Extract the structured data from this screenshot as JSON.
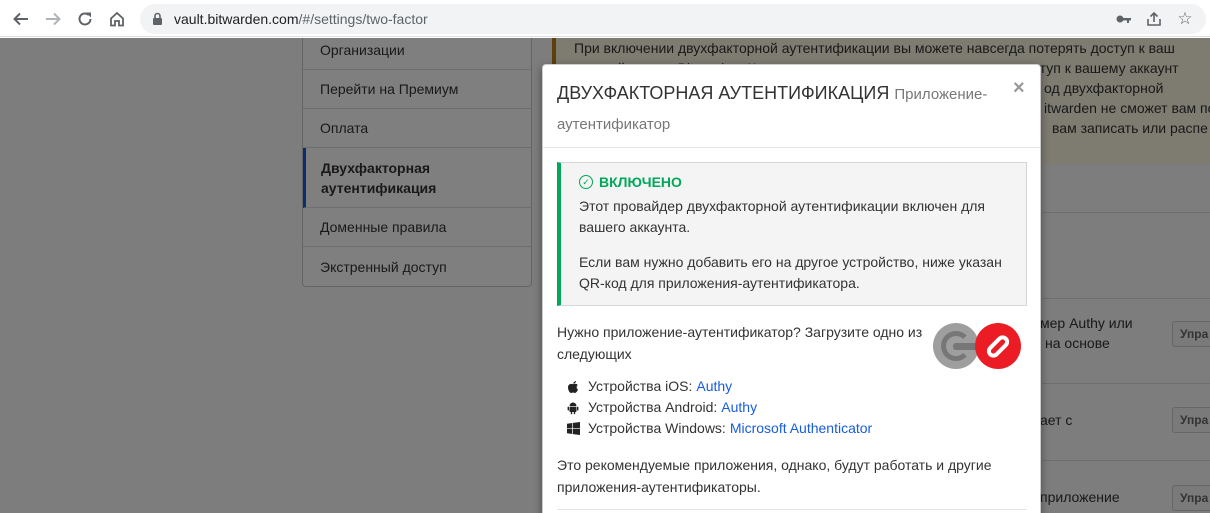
{
  "browser": {
    "url_domain": "vault.bitwarden.com",
    "url_path": "/#/settings/two-factor",
    "icons": [
      "back-arrow-icon",
      "forward-arrow-icon",
      "reload-icon",
      "home-icon",
      "lock-icon",
      "key-icon",
      "share-icon",
      "star-icon"
    ]
  },
  "sidebar": {
    "items": [
      {
        "label": "Организации"
      },
      {
        "label": "Перейти на Премиум"
      },
      {
        "label": "Оплата"
      },
      {
        "label": "Двухфакторная аутентификация",
        "active": true
      },
      {
        "label": "Доменные правила"
      },
      {
        "label": "Экстренный доступ"
      }
    ]
  },
  "background": {
    "warning_lines": [
      "При включении двухфакторной аутентификации вы можете навсегда потерять доступ к ваш",
      "учетной записи Bitwarden. Код восстановления позволяет получить доступ к вашему аккаунт",
      "од двухфакторной",
      "itwarden не сможет вам по",
      "вам записать или распе"
    ],
    "rows": [
      {
        "text_line1": "мер Authy или",
        "text_line2": "на основе",
        "button": "Упра"
      },
      {
        "text_line1": "ает с",
        "button": "Упра"
      },
      {
        "text_line1": "приложение",
        "button": "Упра"
      }
    ]
  },
  "modal": {
    "title": "ДВУХФАКТОРНАЯ АУТЕНТИФИКАЦИЯ",
    "subtitle": "Приложение-аутентификатор",
    "close_label": "×",
    "alert": {
      "title": "ВКЛЮЧЕНО",
      "p1": "Этот провайдер двухфакторной аутентификации включен для вашего аккаунта.",
      "p2": "Если вам нужно добавить его на другое устройство, ниже указан QR-код для приложения-аутентификатора."
    },
    "need_text": "Нужно приложение-аутентификатор? Загрузите одно из следующих",
    "platforms": [
      {
        "icon": "apple-icon",
        "label": "Устройства iOS:",
        "link": "Authy"
      },
      {
        "icon": "android-icon",
        "label": "Устройства Android:",
        "link": "Authy"
      },
      {
        "icon": "windows-icon",
        "label": "Устройства Windows:",
        "link": "Microsoft Authenticator"
      }
    ],
    "recommend_text": "Это рекомендуемые приложения, однако, будут работать и другие приложения-аутентификаторы.",
    "colors": {
      "success": "#01a85a",
      "link": "#175ddc",
      "active_border": "#175ddc",
      "warning_border": "#bf7e16"
    }
  }
}
